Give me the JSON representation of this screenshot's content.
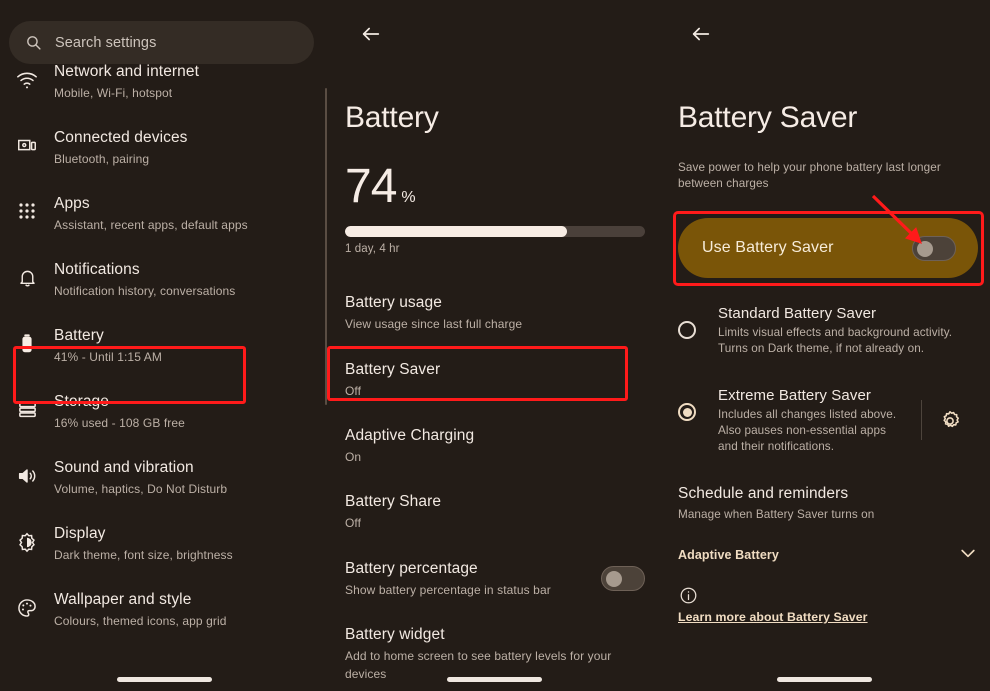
{
  "colors": {
    "background": "#231c17",
    "surface": "#342c25",
    "accent_amber": "#f0dcc2",
    "highlight_card": "#7a5508",
    "annotation_red": "#ff1a1a",
    "text_primary": "#f2e9e2",
    "text_secondary": "#bcb0a6"
  },
  "left_panel": {
    "search": {
      "icon": "search-icon",
      "placeholder": "Search settings",
      "value": "Search settings"
    },
    "items": [
      {
        "icon": "wifi-icon",
        "title": "Network and internet",
        "subtitle": "Mobile, Wi-Fi, hotspot"
      },
      {
        "icon": "devices-icon",
        "title": "Connected devices",
        "subtitle": "Bluetooth, pairing"
      },
      {
        "icon": "apps-grid-icon",
        "title": "Apps",
        "subtitle": "Assistant, recent apps, default apps"
      },
      {
        "icon": "bell-icon",
        "title": "Notifications",
        "subtitle": "Notification history, conversations"
      },
      {
        "icon": "battery-icon",
        "title": "Battery",
        "subtitle": "41% - Until 1:15 AM"
      },
      {
        "icon": "storage-icon",
        "title": "Storage",
        "subtitle": "16% used - 108 GB free"
      },
      {
        "icon": "volume-icon",
        "title": "Sound and vibration",
        "subtitle": "Volume, haptics, Do Not Disturb"
      },
      {
        "icon": "brightness-icon",
        "title": "Display",
        "subtitle": "Dark theme, font size, brightness"
      },
      {
        "icon": "palette-icon",
        "title": "Wallpaper and style",
        "subtitle": "Colours, themed icons, app grid"
      }
    ]
  },
  "middle_panel": {
    "back_icon": "back-arrow-icon",
    "title": "Battery",
    "battery_level": "74",
    "battery_level_symbol": "%",
    "battery_fill_percent": 74,
    "time_remaining": "1 day, 4 hr",
    "rows": [
      {
        "title": "Battery usage",
        "subtitle": "View usage since last full charge"
      },
      {
        "title": "Battery Saver",
        "subtitle": "Off"
      },
      {
        "title": "Adaptive Charging",
        "subtitle": "On"
      },
      {
        "title": "Battery Share",
        "subtitle": "Off"
      },
      {
        "title": "Battery percentage",
        "subtitle": "Show battery percentage in status bar"
      },
      {
        "title": "Battery widget",
        "subtitle": "Add to home screen to see battery levels for your devices"
      }
    ],
    "battery_percentage_toggle": "off"
  },
  "right_panel": {
    "back_icon": "back-arrow-icon",
    "title": "Battery Saver",
    "description": "Save power to help your phone battery last longer between charges",
    "use_battery_saver": {
      "label": "Use Battery Saver",
      "toggle_state": "off"
    },
    "modes": [
      {
        "title": "Standard Battery Saver",
        "description": "Limits visual effects and background activity. Turns on Dark theme, if not already on.",
        "selected": false
      },
      {
        "title": "Extreme Battery Saver",
        "description": "Includes all changes listed above. Also pauses non-essential apps and their notifications.",
        "selected": true
      }
    ],
    "settings_gear_icon": "gear-icon",
    "schedule": {
      "title": "Schedule and reminders",
      "subtitle": "Manage when Battery Saver turns on"
    },
    "adaptive_battery": {
      "label": "Adaptive Battery",
      "chevron": "chevron-down-icon"
    },
    "info_icon": "info-icon",
    "learn_more": "Learn more about Battery Saver"
  }
}
